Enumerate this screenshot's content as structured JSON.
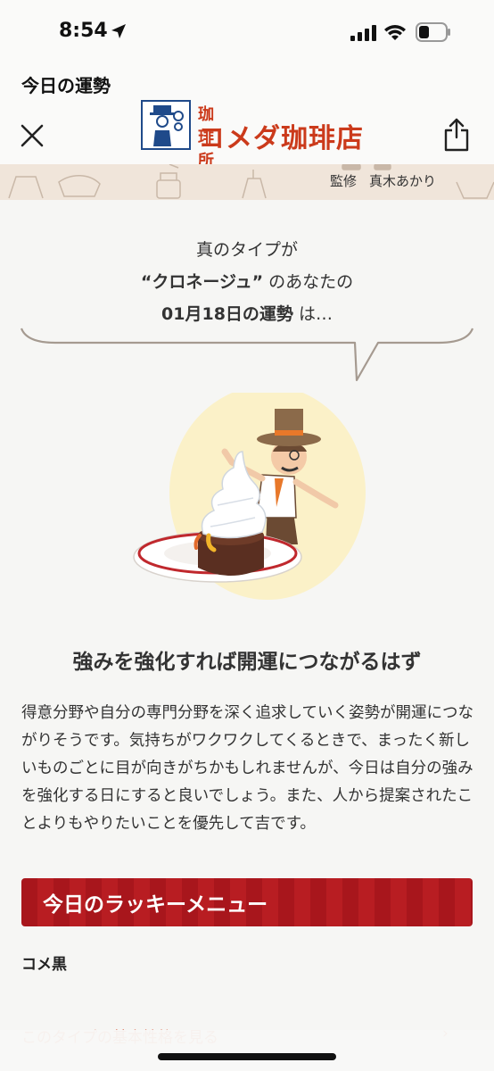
{
  "status_bar": {
    "time": "8:54"
  },
  "nav": {
    "title": "今日の運勢",
    "logo_small": "珈琲所",
    "logo_big": "コメダ珈琲店"
  },
  "header": {
    "supervisor_label": "監修",
    "supervisor_name": "真木あかり"
  },
  "intro": {
    "line1": "真のタイプが",
    "type_name": "“クロネージュ”",
    "line2_suffix": " のあなたの",
    "date_label": "01月18日の運勢",
    "line3_suffix": " は…"
  },
  "fortune": {
    "headline": "強みを強化すれば開運につながるはず",
    "body": "得意分野や自分の専門分野を深く追求していく姿勢が開運につながりそうです。気持ちがワクワクしてくるときで、まったく新しいものごとに目が向きがちかもしれませんが、今日は自分の強みを強化する日にすると良いでしょう。また、人から提案されたことよりもやりたいことを優先して吉です。"
  },
  "lucky": {
    "title": "今日のラッキーメニュー",
    "item": "コメ黒"
  },
  "link": {
    "label": "このタイプの基本性格を見る"
  },
  "colors": {
    "accent_red": "#a8161c",
    "link_orange": "#d64a2a",
    "logo_red": "#cb3a1b"
  }
}
